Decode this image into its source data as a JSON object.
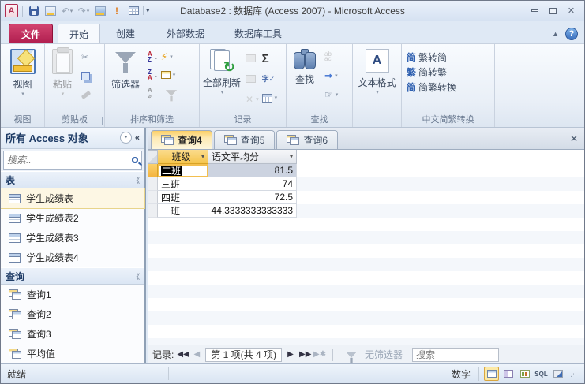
{
  "window": {
    "title": "Database2 : 数据库 (Access 2007) - Microsoft Access"
  },
  "ribbon": {
    "tabs": {
      "file": "文件",
      "home": "开始",
      "create": "创建",
      "external": "外部数据",
      "tools": "数据库工具"
    },
    "groups": {
      "views": {
        "caption": "视图",
        "button": "视图"
      },
      "clipboard": {
        "caption": "剪贴板",
        "paste": "粘贴"
      },
      "sort": {
        "caption": "排序和筛选",
        "filter": "筛选器"
      },
      "records": {
        "caption": "记录",
        "refresh": "全部刷新"
      },
      "find": {
        "caption": "查找",
        "find": "查找"
      },
      "text": {
        "caption": "",
        "button": "文本格式"
      },
      "chinese": {
        "caption": "中文简繁转换",
        "items": [
          {
            "icon": "简",
            "label": "繁转简"
          },
          {
            "icon": "繁",
            "label": "简转繁"
          },
          {
            "icon": "简",
            "label": "简繁转换"
          }
        ]
      }
    },
    "glyphs": {
      "sigma": "Σ",
      "refresh_arrow": "↻",
      "spell": "字A",
      "replace": "ab\nac",
      "help": "?"
    }
  },
  "nav": {
    "header": "所有 Access 对象",
    "search_placeholder": "搜索..",
    "tables": {
      "title": "表",
      "items": [
        "学生成绩表",
        "学生成绩表2",
        "学生成绩表3",
        "学生成绩表4"
      ]
    },
    "queries": {
      "title": "查询",
      "items": [
        "查询1",
        "查询2",
        "查询3",
        "平均值"
      ]
    }
  },
  "main": {
    "doc_tabs": [
      "查询4",
      "查询5",
      "查询6"
    ],
    "active_tab": "查询4",
    "datasheet": {
      "columns": [
        "班级",
        "语文平均分"
      ],
      "rows": [
        {
          "class": "二班",
          "score": "81.5"
        },
        {
          "class": "三班",
          "score": "74"
        },
        {
          "class": "四班",
          "score": "72.5"
        },
        {
          "class": "一班",
          "score": "44.3333333333333"
        }
      ]
    },
    "record_nav": {
      "label": "记录:",
      "position": "第 1 项(共 4 项)",
      "no_filter": "无筛选器",
      "search_placeholder": "搜索"
    }
  },
  "statusbar": {
    "left": "就绪",
    "numlock": "数字",
    "sql": "SQL"
  },
  "colors": {
    "file_tab": "#b01e4f",
    "active_doc_tab": "#fccf63",
    "active_column_header": "#f5c54e",
    "selection_cell": "#ccd3e0"
  }
}
